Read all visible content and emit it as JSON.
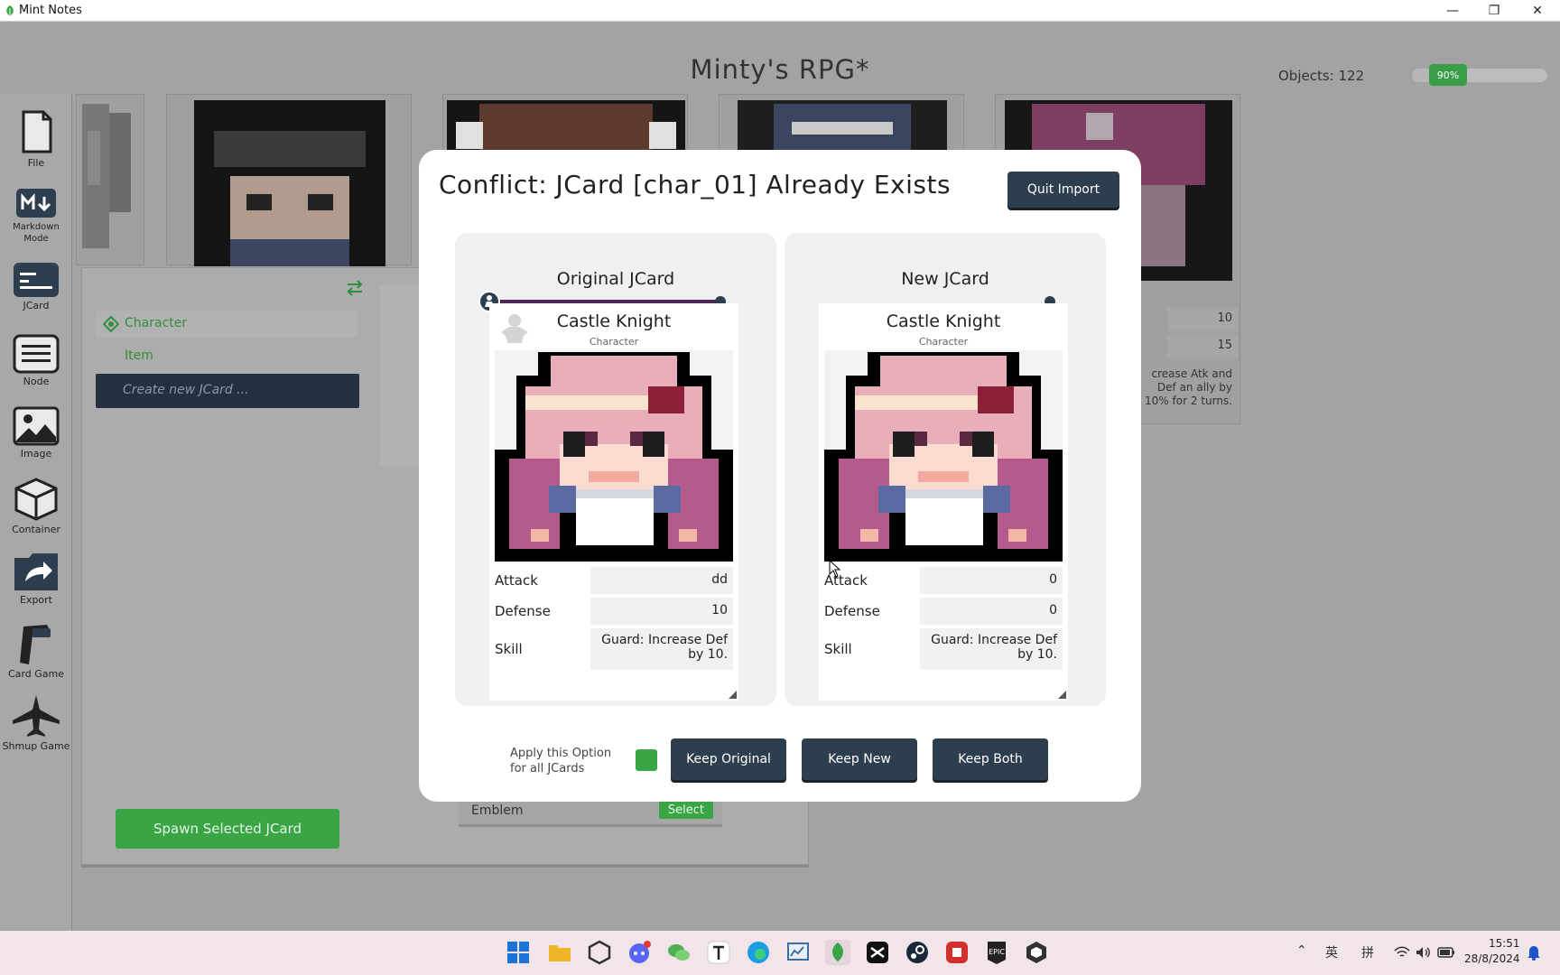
{
  "window": {
    "title": "Mint Notes"
  },
  "header": {
    "title": "Minty's RPG*",
    "objects_label": "Objects: 122",
    "zoom": "90%",
    "zoom_fraction": 0.9
  },
  "sidebar": {
    "items": [
      {
        "label": "File",
        "icon": "file-icon"
      },
      {
        "label": "Markdown Mode",
        "icon": "markdown-icon"
      },
      {
        "label": "JCard",
        "icon": "jcard-icon"
      },
      {
        "label": "Node",
        "icon": "node-icon"
      },
      {
        "label": "Image",
        "icon": "image-icon"
      },
      {
        "label": "Container",
        "icon": "container-icon"
      },
      {
        "label": "Export",
        "icon": "export-icon"
      },
      {
        "label": "Card Game",
        "icon": "card-game-icon"
      },
      {
        "label": "Shmup Game",
        "icon": "shmup-game-icon"
      }
    ]
  },
  "jcard_panel": {
    "categories": [
      "Character",
      "Item"
    ],
    "create_placeholder": "Create new JCard ...",
    "spawn_label": "Spawn Selected JCard",
    "emblem_label": "Emblem",
    "select_label": "Select"
  },
  "modal": {
    "title": "Conflict: JCard [char_01] Already Exists",
    "quit_label": "Quit Import",
    "original": {
      "heading": "Original JCard",
      "name": "Castle Knight",
      "type": "Character",
      "stats": [
        {
          "label": "Attack",
          "value": "dd"
        },
        {
          "label": "Defense",
          "value": "10"
        },
        {
          "label": "Skill",
          "value": "Guard: Increase Def by 10."
        }
      ]
    },
    "new": {
      "heading": "New JCard",
      "name": "Castle Knight",
      "type": "Character",
      "stats": [
        {
          "label": "Attack",
          "value": "0"
        },
        {
          "label": "Defense",
          "value": "0"
        },
        {
          "label": "Skill",
          "value": "Guard: Increase Def by 10."
        }
      ]
    },
    "apply_label": "Apply this Option for all JCards",
    "buttons": {
      "keep_original": "Keep Original",
      "keep_new": "Keep New",
      "keep_both": "Keep Both"
    }
  },
  "taskbar": {
    "ime_1": "英",
    "ime_2": "拼",
    "time": "15:51",
    "date": "28/8/2024"
  },
  "colors": {
    "accent": "#3aa545",
    "dark": "#2d3e4e",
    "canvas": "#a3a3a3"
  }
}
